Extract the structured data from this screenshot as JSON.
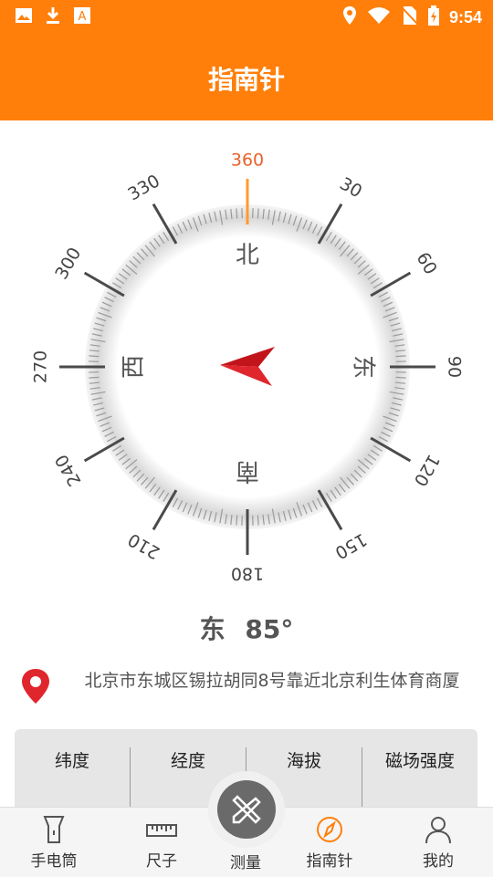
{
  "status": {
    "time": "9:54"
  },
  "title": "指南针",
  "compass": {
    "degree_labels": [
      "360",
      "30",
      "60",
      "90",
      "120",
      "150",
      "180",
      "210",
      "240",
      "270",
      "300",
      "330"
    ],
    "directions": {
      "north": "北",
      "east": "东",
      "south": "南",
      "west": "西"
    },
    "heading_degrees": 85
  },
  "heading": {
    "direction": "东",
    "value": "85°"
  },
  "location": {
    "address": "北京市东城区锡拉胡同8号靠近北京利生体育商厦"
  },
  "info": {
    "latitude": "纬度",
    "longitude": "经度",
    "altitude": "海拔",
    "magnetic": "磁场强度"
  },
  "nav": {
    "flashlight": "手电筒",
    "ruler": "尺子",
    "measure": "测量",
    "compass": "指南针",
    "mine": "我的"
  },
  "colors": {
    "accent": "#ff7f0a",
    "needle": "#c2151b",
    "north_label": "#e8622a"
  }
}
